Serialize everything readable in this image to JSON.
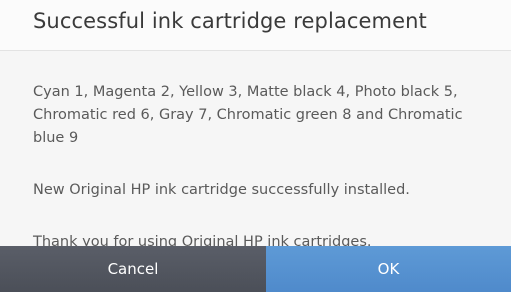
{
  "dialog": {
    "title": "Successful ink cartridge replacement",
    "paragraphs": {
      "cartridges": "Cyan 1, Magenta 2, Yellow 3, Matte black 4, Photo black 5, Chromatic red 6, Gray 7, Chromatic green 8 and Chromatic blue 9",
      "installed": "New Original HP ink cartridge successfully installed.",
      "thanks": "Thank you for using Original HP ink cartridges."
    },
    "buttons": {
      "cancel": "Cancel",
      "ok": "OK"
    }
  },
  "colors": {
    "cancel_button": "#50545d",
    "ok_button": "#5592d1",
    "text": "#5a5a5a"
  }
}
